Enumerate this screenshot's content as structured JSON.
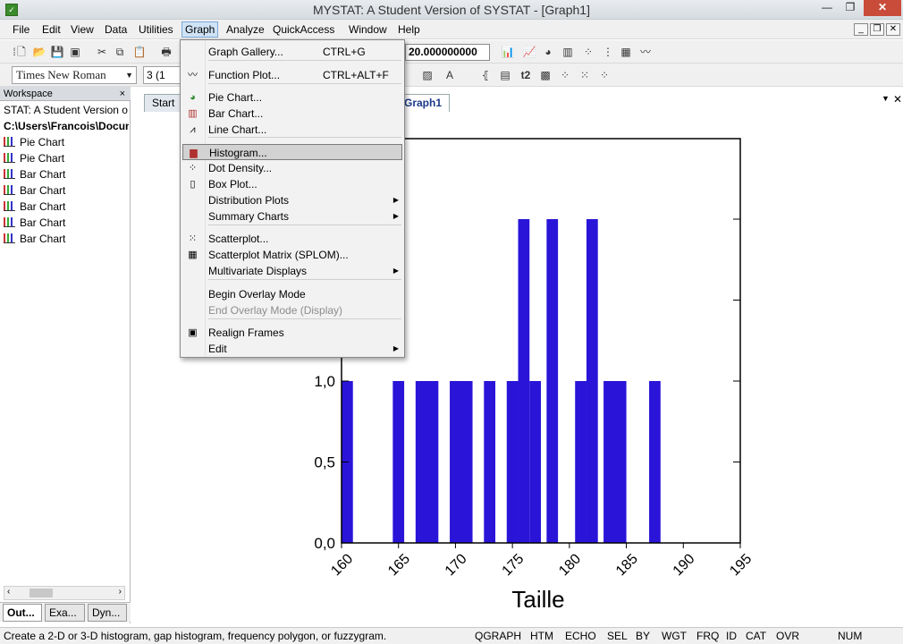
{
  "window": {
    "title": "MYSTAT: A Student Version of SYSTAT - [Graph1]",
    "min": "—",
    "max": "❐",
    "close": "✕"
  },
  "menubar": [
    "File",
    "Edit",
    "View",
    "Data",
    "Utilities",
    "Graph",
    "Analyze",
    "QuickAccess",
    "Window",
    "Help"
  ],
  "toolbar": {
    "font_name": "Times New Roman",
    "font_size": "3 (1",
    "value_field": "20.000000000"
  },
  "workspace": {
    "title": "Workspace",
    "close": "×",
    "items": [
      "STAT: A Student Version o",
      "C:\\Users\\Francois\\Docun",
      "Pie Chart",
      "Pie Chart",
      "Bar Chart",
      "Bar Chart",
      "Bar Chart",
      "Bar Chart",
      "Bar Chart"
    ],
    "tabs": [
      "Out...",
      "Exa...",
      "Dyn..."
    ]
  },
  "doc_tabs": [
    "Start",
    "Graph1"
  ],
  "graph_menu": {
    "items": [
      {
        "label": "Graph Gallery...",
        "accel": "CTRL+G",
        "icon": ""
      },
      {
        "label": "Function Plot...",
        "accel": "CTRL+ALT+F",
        "icon": "function-plot-icon"
      },
      {
        "label": "Pie Chart...",
        "icon": "pie-chart-icon"
      },
      {
        "label": "Bar Chart...",
        "icon": "bar-chart-icon"
      },
      {
        "label": "Line Chart...",
        "icon": "line-chart-icon"
      },
      {
        "label": "Histogram...",
        "icon": "histogram-icon",
        "selected": true
      },
      {
        "label": "Dot Density...",
        "icon": "dot-density-icon"
      },
      {
        "label": "Box Plot...",
        "icon": "box-plot-icon"
      },
      {
        "label": "Distribution Plots",
        "submenu": true
      },
      {
        "label": "Summary Charts",
        "submenu": true
      },
      {
        "label": "Scatterplot...",
        "icon": "scatterplot-icon"
      },
      {
        "label": "Scatterplot Matrix (SPLOM)...",
        "icon": "splom-icon"
      },
      {
        "label": "Multivariate Displays",
        "submenu": true
      },
      {
        "label": "Begin Overlay Mode"
      },
      {
        "label": "End Overlay Mode (Display)",
        "disabled": true
      },
      {
        "label": "Realign Frames",
        "icon": "realign-frames-icon"
      },
      {
        "label": "Edit",
        "submenu": true
      }
    ]
  },
  "chart_data": {
    "type": "bar",
    "xlabel": "Taille",
    "ylabel": "",
    "xlim": [
      160,
      195
    ],
    "ylim": [
      0,
      2
    ],
    "x_ticks": [
      "160",
      "165",
      "170",
      "175",
      "180",
      "185",
      "190",
      "195"
    ],
    "y_ticks": [
      "0,0",
      "0,5",
      "1,0"
    ],
    "bins": [
      {
        "x0": 160.0,
        "x1": 161.0,
        "count": 1
      },
      {
        "x0": 164.5,
        "x1": 165.5,
        "count": 1
      },
      {
        "x0": 166.5,
        "x1": 168.5,
        "count": 1
      },
      {
        "x0": 169.5,
        "x1": 171.5,
        "count": 1
      },
      {
        "x0": 172.5,
        "x1": 173.5,
        "count": 1
      },
      {
        "x0": 174.5,
        "x1": 175.5,
        "count": 1
      },
      {
        "x0": 175.5,
        "x1": 176.5,
        "count": 2
      },
      {
        "x0": 176.5,
        "x1": 177.5,
        "count": 1
      },
      {
        "x0": 178.0,
        "x1": 179.0,
        "count": 2
      },
      {
        "x0": 180.5,
        "x1": 181.5,
        "count": 1
      },
      {
        "x0": 181.5,
        "x1": 182.5,
        "count": 2
      },
      {
        "x0": 183.0,
        "x1": 185.0,
        "count": 1
      },
      {
        "x0": 187.0,
        "x1": 188.0,
        "count": 1
      }
    ],
    "bar_color": "#2a14d8"
  },
  "status": {
    "message": "Create a 2-D or 3-D histogram, gap histogram, frequency polygon, or fuzzygram.",
    "panes": [
      "QGRAPH",
      "HTM",
      "ECHO",
      "SEL",
      "BY",
      "WGT",
      "FRQ",
      "ID",
      "CAT",
      "OVR",
      "NUM"
    ]
  }
}
